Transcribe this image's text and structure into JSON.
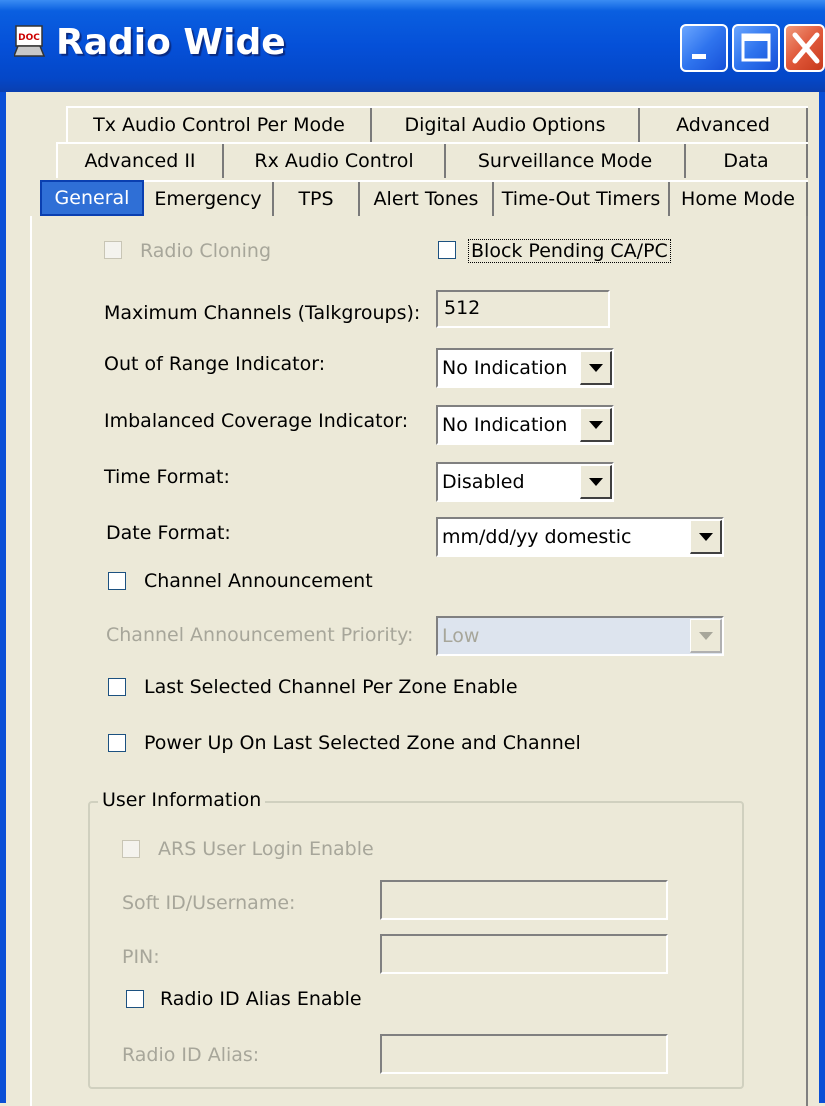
{
  "window": {
    "title": "Radio Wide",
    "icon": "doc-icon"
  },
  "title_buttons": {
    "minimize": "minimize-icon",
    "maximize": "maximize-icon",
    "close": "close-icon"
  },
  "tabs": {
    "row1": [
      "Tx Audio Control Per Mode",
      "Digital Audio Options",
      "Advanced"
    ],
    "row2": [
      "Advanced II",
      "Rx Audio Control",
      "Surveillance Mode",
      "Data"
    ],
    "row3": [
      "General",
      "Emergency",
      "TPS",
      "Alert Tones",
      "Time-Out Timers",
      "Home Mode"
    ],
    "active": "General"
  },
  "general": {
    "radio_cloning": {
      "label": "Radio Cloning",
      "checked": false,
      "enabled": false
    },
    "block_pending": {
      "label": "Block Pending CA/PC",
      "checked": false
    },
    "max_channels": {
      "label": "Maximum Channels (Talkgroups):",
      "value": "512"
    },
    "out_of_range": {
      "label": "Out of Range Indicator:",
      "value": "No Indication"
    },
    "imbalanced": {
      "label": "Imbalanced Coverage Indicator:",
      "value": "No Indication"
    },
    "time_format": {
      "label": "Time Format:",
      "value": "Disabled"
    },
    "date_format": {
      "label": "Date Format:",
      "value": "mm/dd/yy domestic"
    },
    "channel_announcement": {
      "label": "Channel Announcement",
      "checked": false
    },
    "channel_announcement_priority": {
      "label": "Channel Announcement Priority:",
      "value": "Low",
      "enabled": false
    },
    "last_selected_channel": {
      "label": "Last Selected Channel Per Zone Enable",
      "checked": false
    },
    "power_up_last": {
      "label": "Power Up On Last Selected Zone and Channel",
      "checked": false
    }
  },
  "user_info": {
    "title": "User Information",
    "ars_login": {
      "label": "ARS User Login Enable",
      "checked": false,
      "enabled": false
    },
    "soft_id": {
      "label": "Soft ID/Username:",
      "value": ""
    },
    "pin": {
      "label": "PIN:",
      "value": ""
    },
    "radio_id_alias_enable": {
      "label": "Radio ID Alias Enable",
      "checked": false
    },
    "radio_id_alias": {
      "label": "Radio ID Alias:",
      "value": ""
    }
  },
  "colors": {
    "title_bar": "#0550d8",
    "face": "#ece9d8",
    "active_tab": "#2f6fd6",
    "disabled_text": "#a7a69a"
  }
}
